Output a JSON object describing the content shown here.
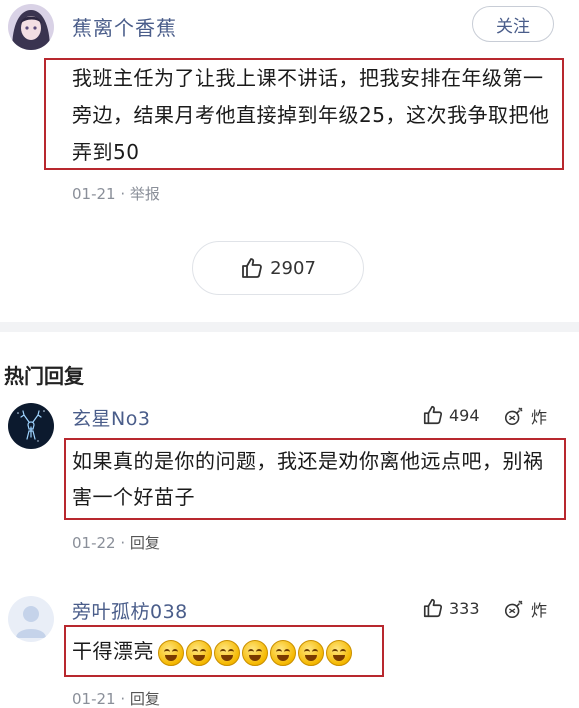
{
  "post": {
    "username": "蕉离个香蕉",
    "follow_label": "关注",
    "content": "我班主任为了让我上课不讲话，把我安排在年级第一旁边，结果月考他直接掉到年级25，这次我争取把他弄到50",
    "date": "01-21",
    "report_label": "举报",
    "likes": "2907"
  },
  "hot_replies": {
    "title": "热门回复",
    "comments": [
      {
        "username": "玄星No3",
        "likes": "494",
        "boom_label": "炸",
        "content": "如果真的是你的问题，我还是劝你离他远点吧，别祸害一个好苗子",
        "date": "01-22",
        "reply_label": "回复"
      },
      {
        "username": "旁叶孤枋038",
        "likes": "333",
        "boom_label": "炸",
        "content": "干得漂亮",
        "emoji_count": 7,
        "date": "01-21",
        "reply_label": "回复"
      }
    ]
  },
  "colors": {
    "username": "#4a5d8a",
    "highlight_box": "#b8282e",
    "meta": "#8a8f99"
  }
}
